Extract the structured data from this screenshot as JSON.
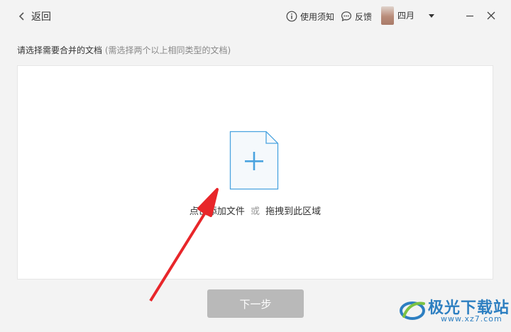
{
  "header": {
    "back_label": "返回",
    "help_label": "使用须知",
    "feedback_label": "反馈",
    "username": "四月"
  },
  "main": {
    "instruction": "请选择需要合并的文档",
    "instruction_hint": "(需选择两个以上相同类型的文档)",
    "drop_add": "点击添加文件",
    "drop_or": "或",
    "drop_drag": "拖拽到此区域",
    "next_label": "下一步"
  },
  "watermark": {
    "text": "极光下载站",
    "url": "www.xz7.com"
  },
  "colors": {
    "accent": "#4aa3df",
    "button_disabled": "#b9b9b9",
    "arrow": "#e8262a",
    "watermark": "#2d7fc1"
  }
}
